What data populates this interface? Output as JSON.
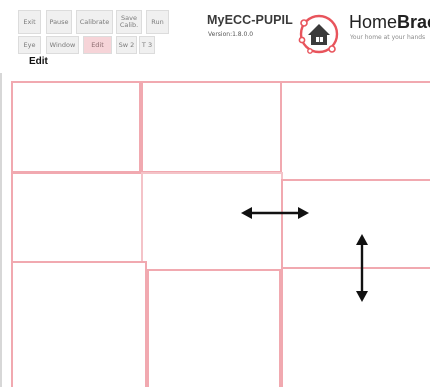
{
  "toolbar": {
    "row1": [
      "Exit",
      "Pause",
      "Calibrate",
      "Save\nCalib.",
      "Run"
    ],
    "row2": [
      "Eye",
      "Window",
      "Edit",
      "Sw 2",
      "T 3"
    ]
  },
  "mode_label": "Edit",
  "app": {
    "title": "MyECC-PUPIL",
    "version": "Version:1.8.0.0"
  },
  "logo": {
    "name_light": "Home",
    "name_bold": "Brace",
    "tagline": "Your home at your hands"
  },
  "colors": {
    "pane_border": "#f1a9b0",
    "active_button": "#f6d4d8",
    "arrow": "#111111",
    "logo_red": "#e8545c",
    "logo_house": "#3b3b3b"
  },
  "icons": {
    "horizontal_arrow": "left-right-arrow-icon",
    "vertical_arrow": "up-down-arrow-icon",
    "logo": "home-brace-logo-icon"
  }
}
